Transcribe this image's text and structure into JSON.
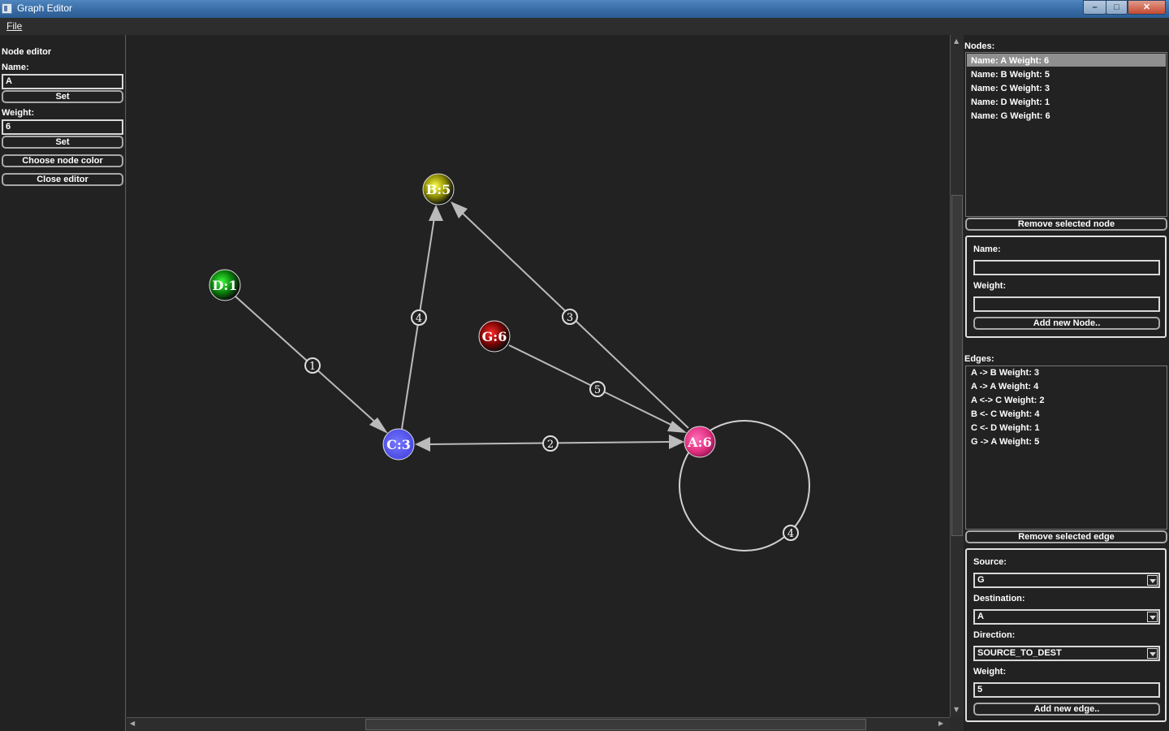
{
  "window": {
    "title": "Graph Editor",
    "minimize": "–",
    "maximize": "□",
    "close": "✕"
  },
  "menu": {
    "file": "File"
  },
  "node_editor": {
    "heading": "Node editor",
    "name_label": "Name:",
    "name_value": "A",
    "set_name": "Set",
    "weight_label": "Weight:",
    "weight_value": "6",
    "set_weight": "Set",
    "choose_color": "Choose node color",
    "close_editor": "Close editor"
  },
  "graph": {
    "nodes": [
      {
        "label": "B:5",
        "color": "#d8d800"
      },
      {
        "label": "D:1",
        "color": "#13c013"
      },
      {
        "label": "G:6",
        "color": "#c80a0a"
      },
      {
        "label": "C:3",
        "color": "#5555ff"
      },
      {
        "label": "A:6",
        "color": "#ff4aa6"
      }
    ],
    "edges": [
      {
        "weight": "1"
      },
      {
        "weight": "4"
      },
      {
        "weight": "3"
      },
      {
        "weight": "5"
      },
      {
        "weight": "2"
      },
      {
        "weight": "4"
      }
    ]
  },
  "nodes_panel": {
    "label": "Nodes:",
    "items": [
      "Name: A Weight: 6",
      "Name: B Weight: 5",
      "Name: C Weight: 3",
      "Name: D Weight: 1",
      "Name: G Weight: 6"
    ],
    "remove_button": "Remove selected node",
    "name_label": "Name:",
    "name_value": "",
    "weight_label": "Weight:",
    "weight_value": "",
    "add_button": "Add new Node.."
  },
  "edges_panel": {
    "label": "Edges:",
    "items": [
      "A -> B Weight: 3",
      "A -> A Weight: 4",
      "A <-> C Weight: 2",
      "B <- C Weight: 4",
      "C <- D Weight: 1",
      "G -> A Weight: 5"
    ],
    "remove_button": "Remove selected edge",
    "source_label": "Source:",
    "source_value": "G",
    "destination_label": "Destination:",
    "destination_value": "A",
    "direction_label": "Direction:",
    "direction_value": "SOURCE_TO_DEST",
    "weight_label": "Weight:",
    "weight_value": "5",
    "add_button": "Add new edge.."
  }
}
